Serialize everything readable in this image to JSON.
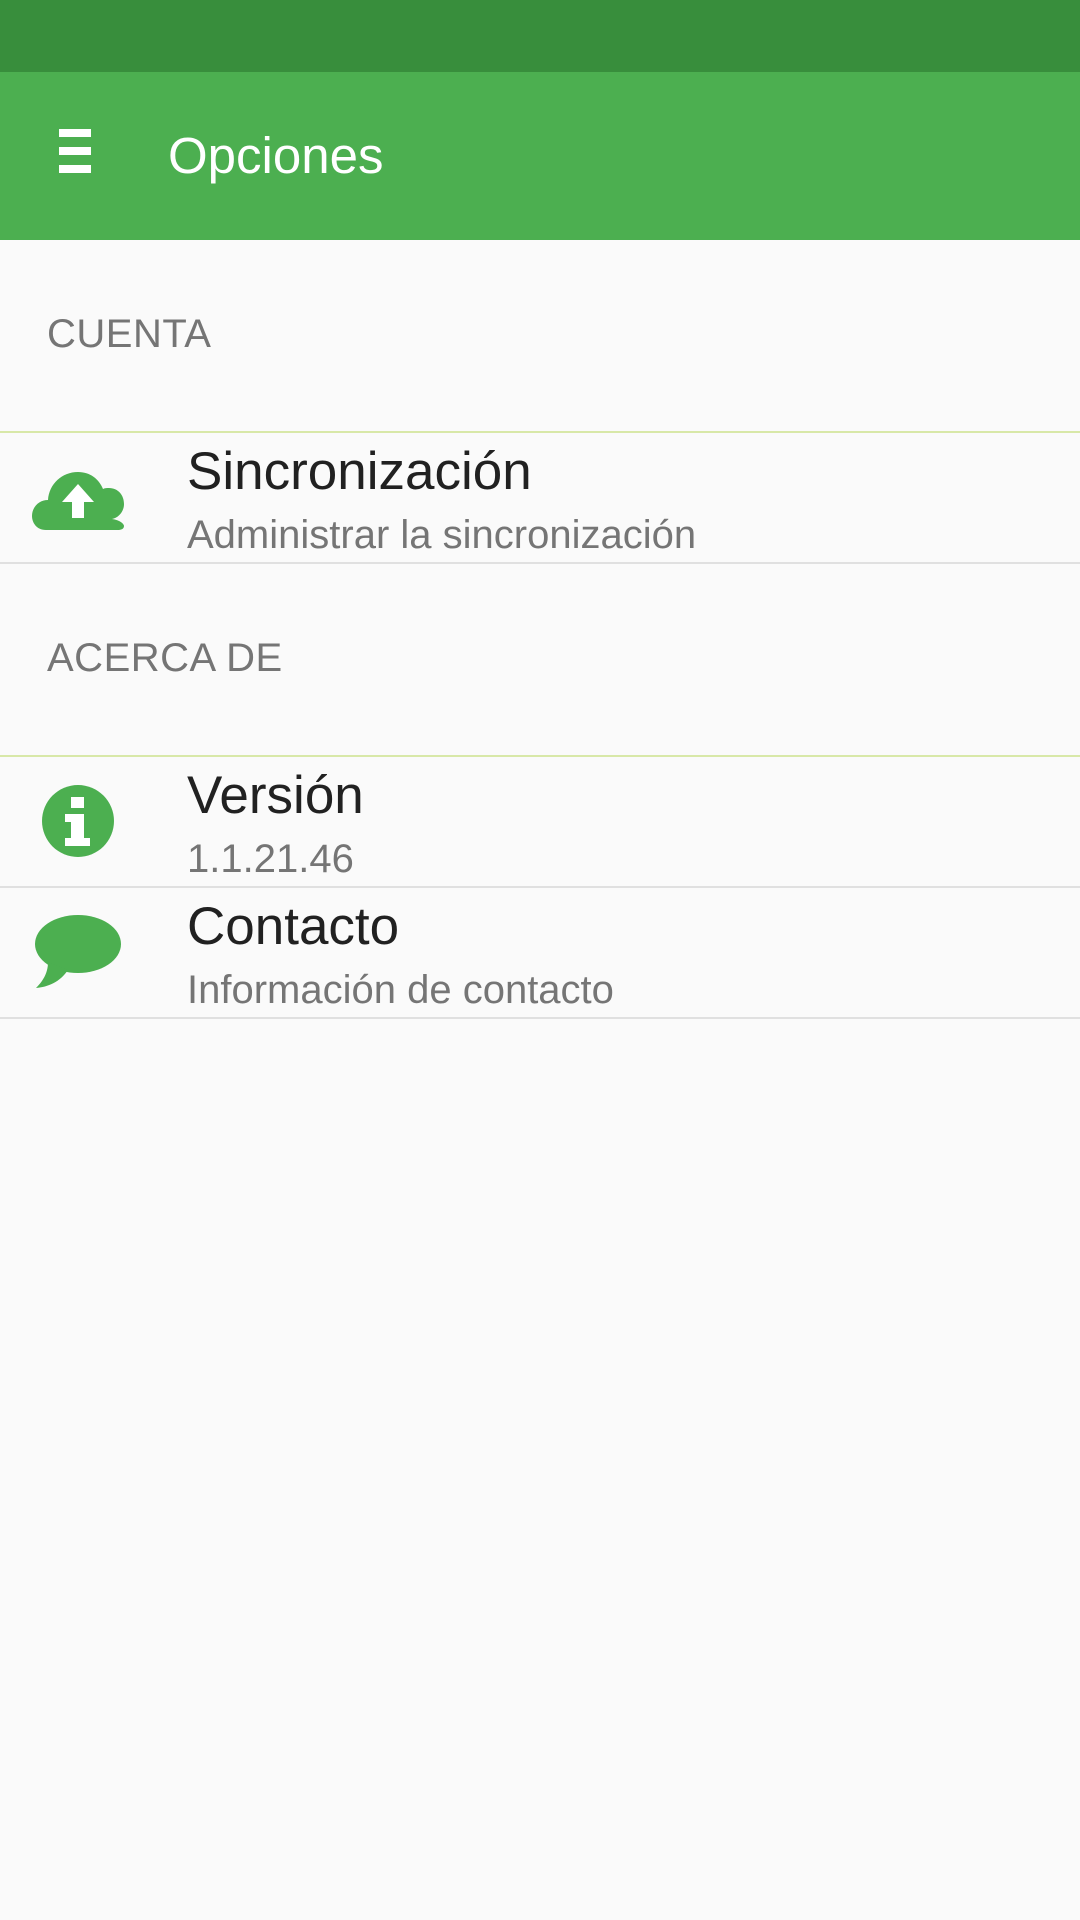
{
  "app_bar": {
    "title": "Opciones",
    "menu_icon": "menu-icon"
  },
  "colors": {
    "status_bar": "#388e3c",
    "primary": "#4caf50",
    "background": "#fafafa",
    "title_text": "#212121",
    "secondary_text": "#757575"
  },
  "sections": [
    {
      "header": "CUENTA",
      "items": [
        {
          "title": "Sincronización",
          "summary": "Administrar la sincronización",
          "icon": "cloud-upload-icon"
        }
      ]
    },
    {
      "header": "ACERCA DE",
      "items": [
        {
          "title": "Versión",
          "summary": "1.1.21.46",
          "icon": "info-icon"
        },
        {
          "title": "Contacto",
          "summary": "Información de contacto",
          "icon": "chat-bubble-icon"
        }
      ]
    }
  ]
}
